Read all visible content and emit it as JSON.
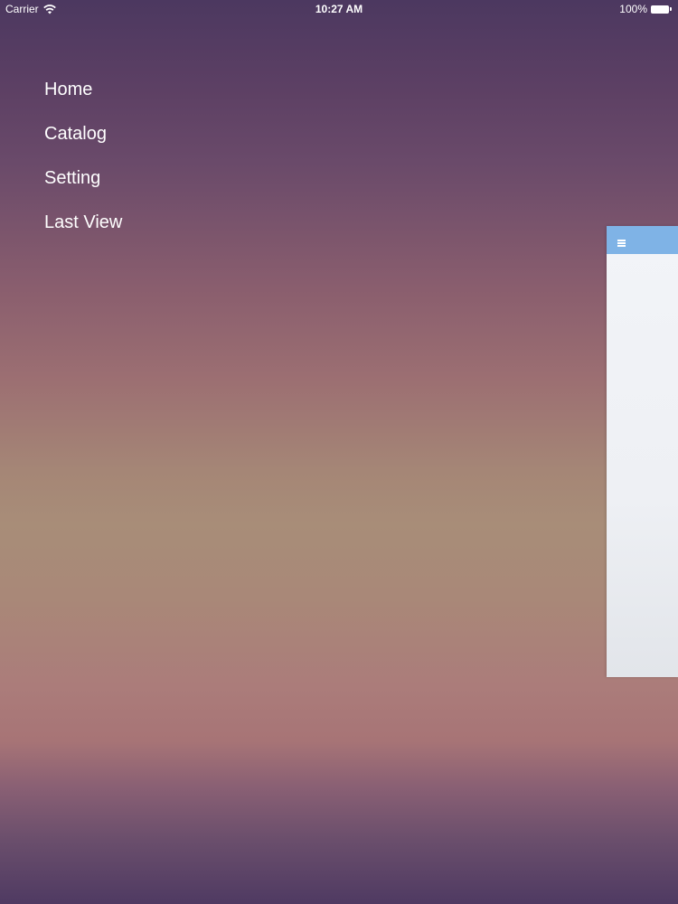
{
  "status_bar": {
    "carrier": "Carrier",
    "time": "10:27 AM",
    "battery": "100%",
    "wifi_icon": "wifi-icon",
    "battery_icon": "battery-icon"
  },
  "menu": {
    "items": [
      {
        "label": "Home"
      },
      {
        "label": "Catalog"
      },
      {
        "label": "Setting"
      },
      {
        "label": "Last View"
      }
    ]
  },
  "content_panel": {
    "navbar_icon": "hamburger-icon",
    "navbar_color": "#7fb3e6"
  }
}
